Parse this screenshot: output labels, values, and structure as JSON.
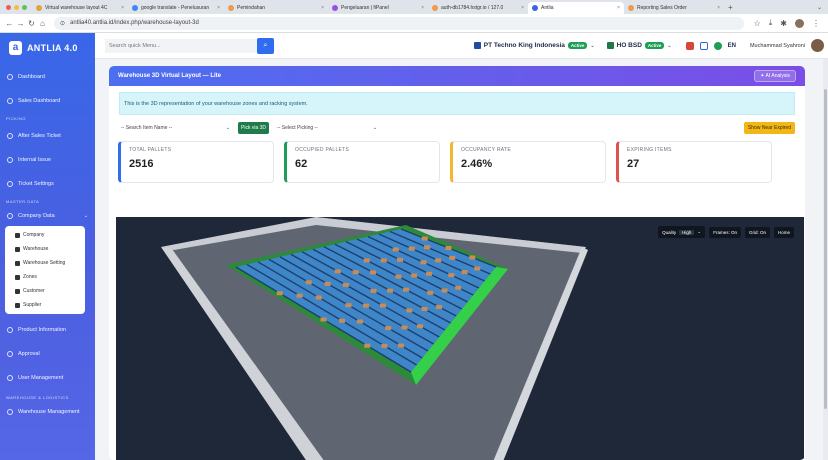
{
  "browser": {
    "tabs": [
      {
        "title": "Virtual warehouse layout 4C",
        "color": "#e6a23c",
        "active": false
      },
      {
        "title": "google translate - Penelusuran",
        "color": "#4285f4",
        "active": false
      },
      {
        "title": "Pemindahan",
        "color": "#f2994a",
        "active": false
      },
      {
        "title": "Pengeluaran | fiPanel",
        "color": "#9b51e0",
        "active": false
      },
      {
        "title": "auth-db1784.hstgr.io / 127.0",
        "color": "#f2994a",
        "active": false
      },
      {
        "title": "Antlia",
        "color": "#3b63e6",
        "active": true
      },
      {
        "title": "Reporting Sales Order",
        "color": "#f2994a",
        "active": false
      }
    ],
    "url": "antlia40.antlia.id/index.php/warehouse-layout-3d"
  },
  "sidebar": {
    "logo_text": "ANTLIA 4.0",
    "items_top": [
      "Dashboard",
      "Sales Dashboard"
    ],
    "section_picking": "PICKING",
    "items_picking": [
      "After Sales Ticket",
      "Internal Issue",
      "Ticket Settings"
    ],
    "section_master": "MASTER DATA",
    "company_data": "Company Data",
    "submenu": [
      "Company",
      "Warehouse",
      "Warehouse Setting",
      "Zones",
      "Customer",
      "Supplier"
    ],
    "items_bottom": [
      "Product Information",
      "Approval",
      "User Management"
    ],
    "section_warehouse": "WAREHOUSE & LOGISTICS",
    "warehouse_mgmt": "Warehouse Management"
  },
  "topbar": {
    "search_placeholder": "Search quick Menu...",
    "company": "PT Techno King Indonesia",
    "company_status": "Active",
    "branch": "HO BSD",
    "branch_status": "Active",
    "lang": "EN",
    "user": "Muchammad Syahroni"
  },
  "page": {
    "title": "Warehouse 3D Virtual Layout — Lite",
    "ai_button": "AI Analysis",
    "info": "This is the 3D representation of your warehouse zones and racking system.",
    "search_item": "-- Search Item Name --",
    "pick_button": "Pick via 3D",
    "select_picking": "-- Select Picking --",
    "near_expired": "Show Near Expired"
  },
  "stats": [
    {
      "label": "TOTAL PALLETS",
      "value": "2516"
    },
    {
      "label": "OCCUPIED PALLETS",
      "value": "62"
    },
    {
      "label": "OCCUPANCY RATE",
      "value": "2.46%"
    },
    {
      "label": "EXPIRING ITEMS",
      "value": "27"
    }
  ],
  "scene_controls": {
    "quality_label": "Quality",
    "quality_value": "High",
    "frames": "Frames: On",
    "grid": "Grid: On",
    "home": "Home"
  }
}
